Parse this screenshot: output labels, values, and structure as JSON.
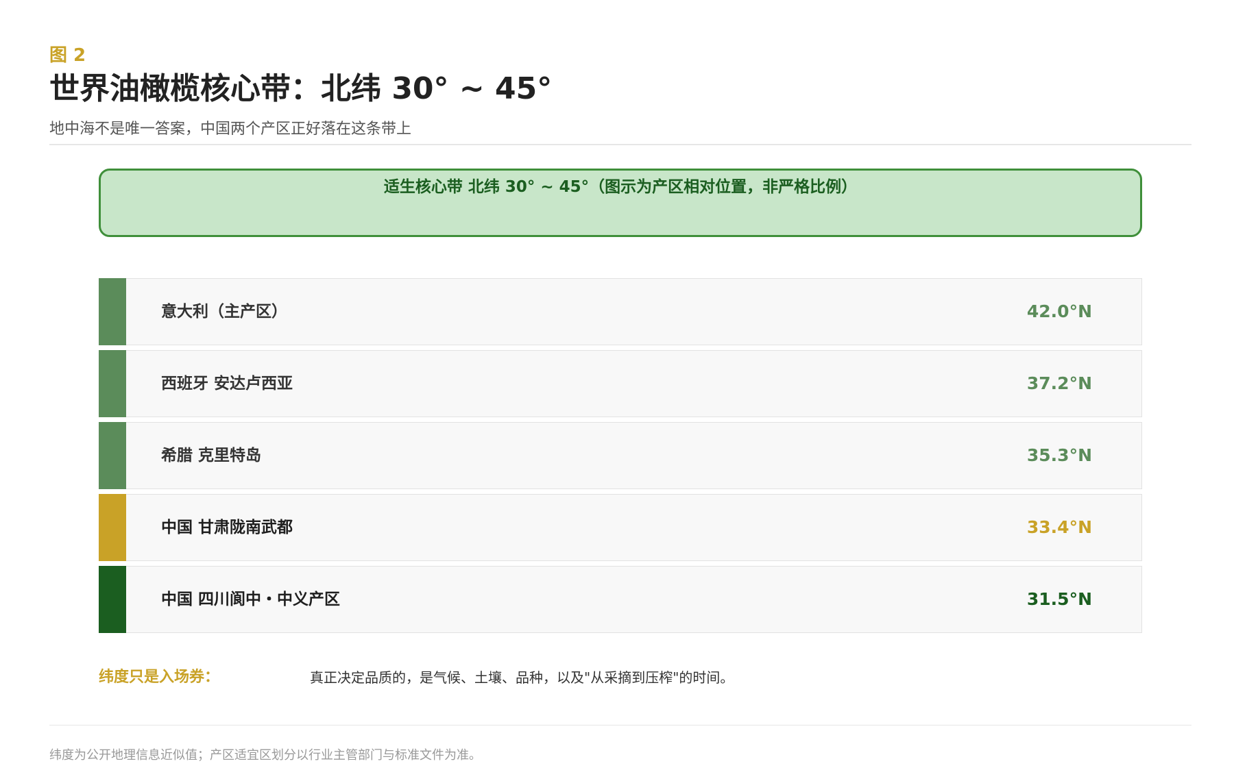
{
  "figure_label": "图 2",
  "title": "世界油橄榄核心带：北纬 30° ~ 45°",
  "subtitle": "地中海不是唯一答案，中国两个产区正好落在这条带上",
  "band": {
    "label": "适生核心带  北纬 30° ~ 45°（图示为产区相对位置，非严格比例）",
    "fill_color": "#c8e6c9",
    "border_color": "#3f8f3a"
  },
  "regions": [
    {
      "name": "意大利（主产区）",
      "latitude": "42.0°N",
      "color": "#5b8c5a"
    },
    {
      "name": "西班牙 安达卢西亚",
      "latitude": "37.2°N",
      "color": "#5b8c5a"
    },
    {
      "name": "希腊 克里特岛",
      "latitude": "35.3°N",
      "color": "#5b8c5a"
    },
    {
      "name": "中国 甘肃陇南武都",
      "latitude": "33.4°N",
      "color": "#c9a227"
    },
    {
      "name": "中国 四川阆中・中义产区",
      "latitude": "31.5°N",
      "color": "#1b5e20"
    }
  ],
  "note": {
    "label": "纬度只是入场券：",
    "text": "真正决定品质的，是气候、土壤、品种，以及\"从采摘到压榨\"的时间。"
  },
  "footnote": "纬度为公开地理信息近似值；产区适宜区划分以行业主管部门与标准文件为准。"
}
